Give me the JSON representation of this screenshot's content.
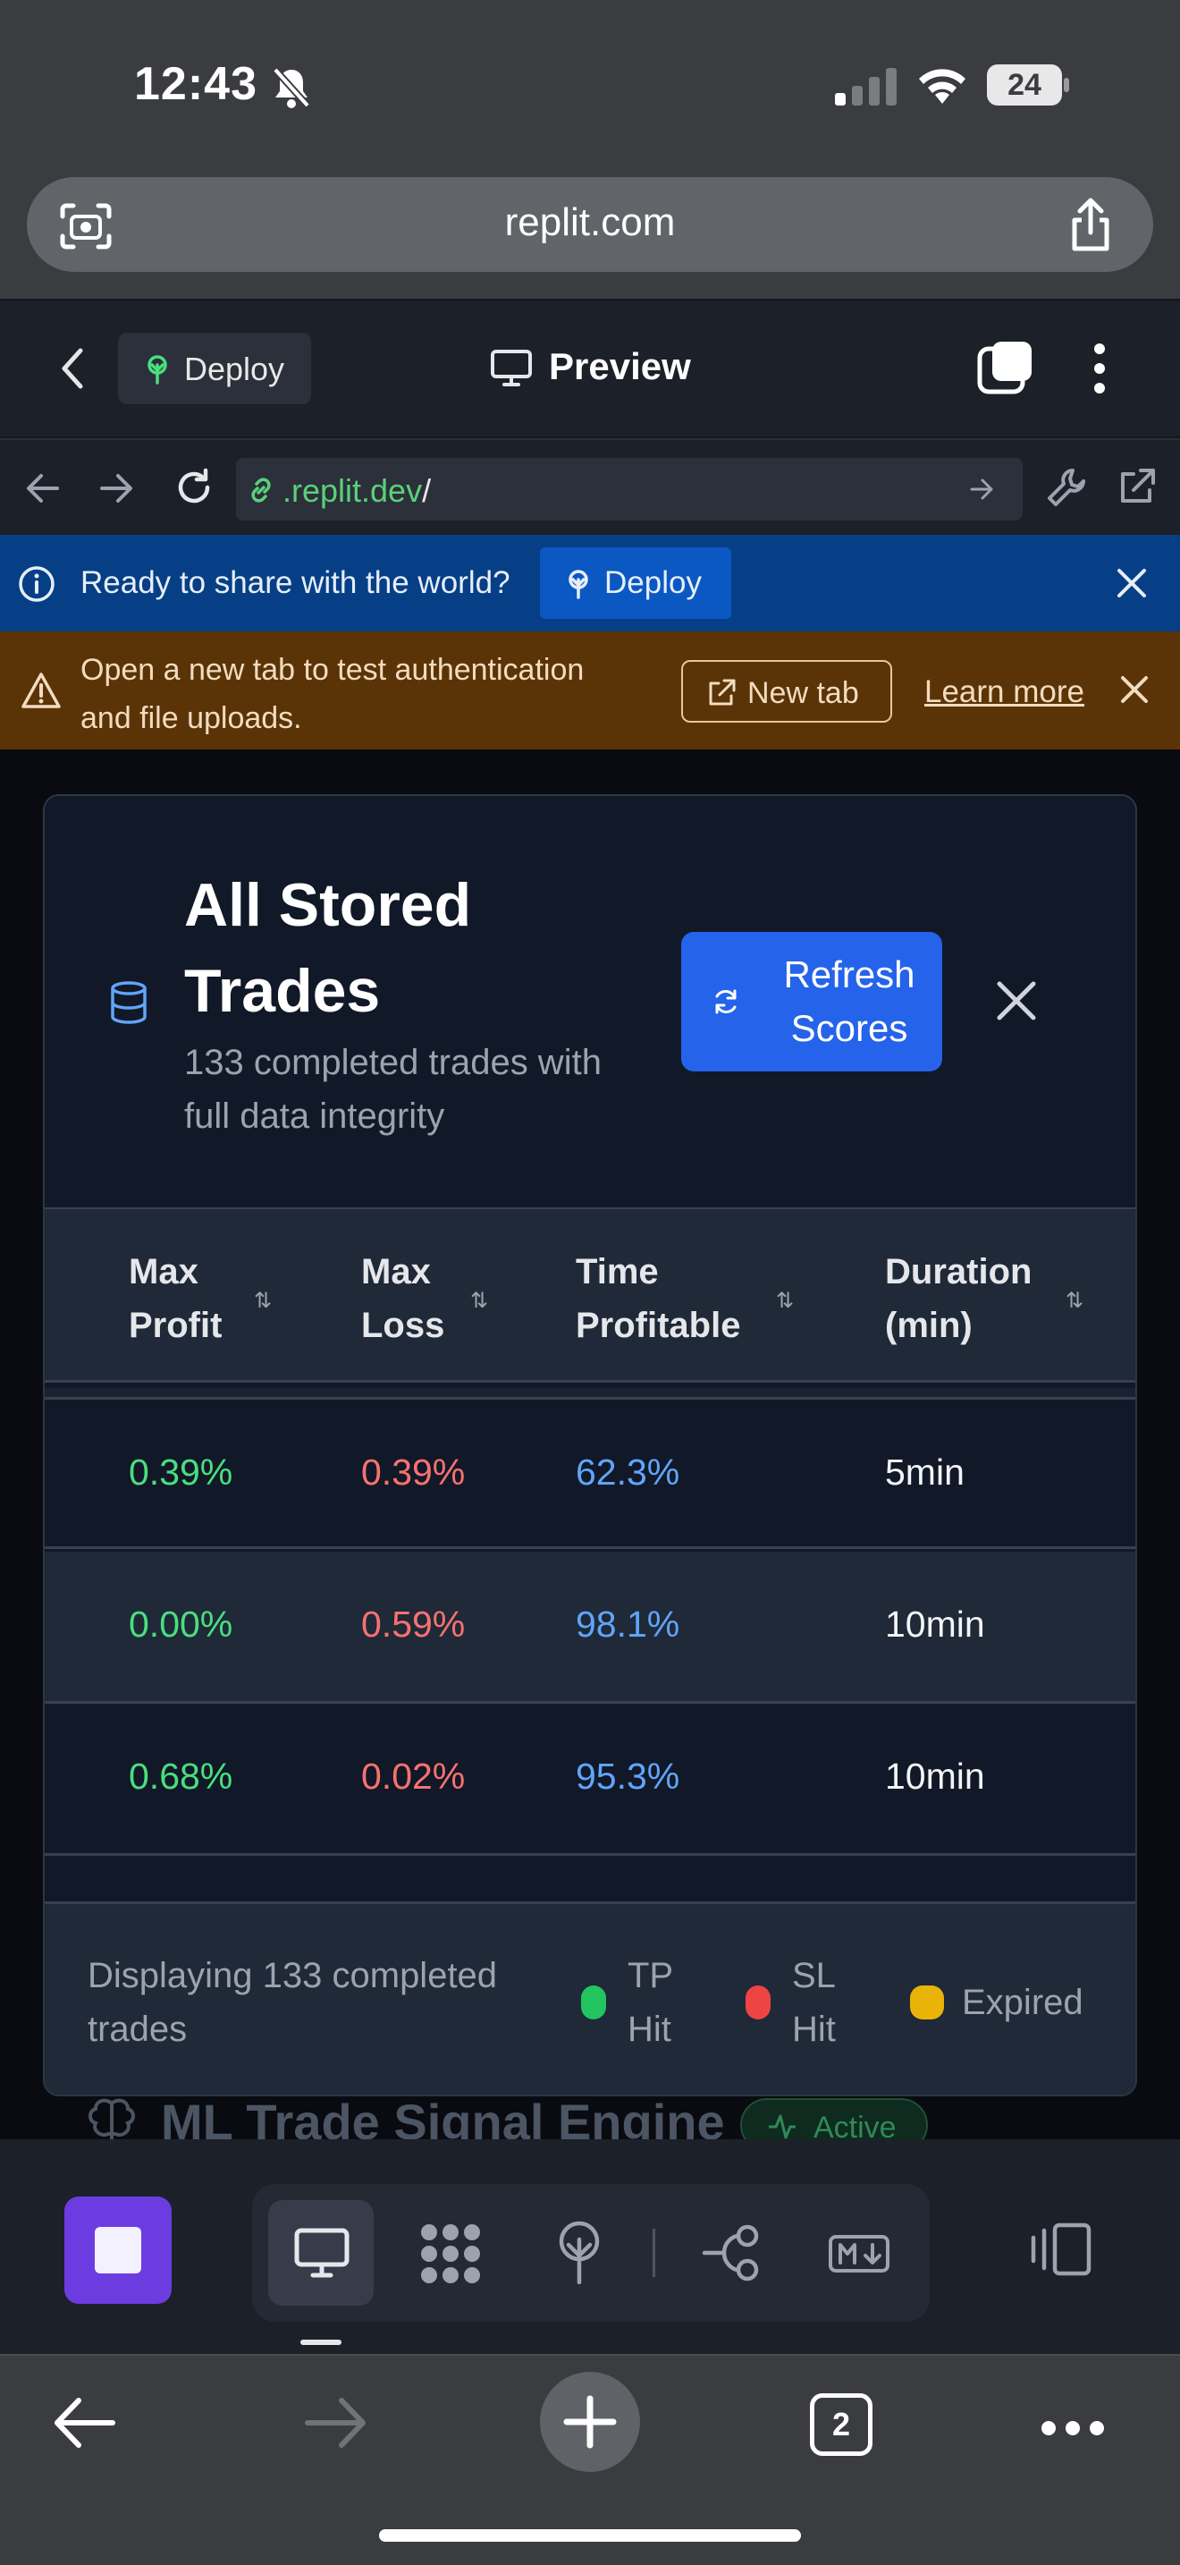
{
  "status_bar": {
    "time": "12:43",
    "battery": "24"
  },
  "safari": {
    "url": "replit.com"
  },
  "replit_header": {
    "deploy_label": "Deploy",
    "title": "Preview"
  },
  "webview": {
    "url_host": ".replit.dev",
    "url_path": "/"
  },
  "share_banner": {
    "text": "Ready to share with the world?",
    "deploy_label": "Deploy"
  },
  "auth_banner": {
    "text_line1": "Open a new tab to test authentication",
    "text_line2": "and file uploads.",
    "new_tab_label": "New tab",
    "learn_more_label": "Learn more"
  },
  "modal": {
    "title_line1": "All Stored",
    "title_line2": "Trades",
    "subtitle_line1": "133 completed trades with",
    "subtitle_line2": "full data integrity",
    "refresh_line1": "Refresh",
    "refresh_line2": "Scores",
    "columns": [
      {
        "line1": "Max",
        "line2": "Profit"
      },
      {
        "line1": "Max",
        "line2": "Loss"
      },
      {
        "line1": "Time",
        "line2": "Profitable"
      },
      {
        "line1": "Duration",
        "line2": "(min)"
      }
    ],
    "rows": [
      {
        "max_profit": "0.39%",
        "max_loss": "0.39%",
        "time_profitable": "62.3%",
        "duration": "5min"
      },
      {
        "max_profit": "0.00%",
        "max_loss": "0.59%",
        "time_profitable": "98.1%",
        "duration": "10min"
      },
      {
        "max_profit": "0.68%",
        "max_loss": "0.02%",
        "time_profitable": "95.3%",
        "duration": "10min"
      }
    ],
    "footer_line1": "Displaying 133 completed",
    "footer_line2": "trades",
    "legend": [
      {
        "line1": "TP",
        "line2": "Hit",
        "color": "#22c55e"
      },
      {
        "line1": "SL",
        "line2": "Hit",
        "color": "#ef4444"
      },
      {
        "line1": "Expired",
        "line2": "",
        "color": "#eab308"
      }
    ]
  },
  "behind": {
    "title": "ML Trade Signal Engine",
    "badge": "Active"
  },
  "safari_bottom": {
    "tab_count": "2"
  }
}
